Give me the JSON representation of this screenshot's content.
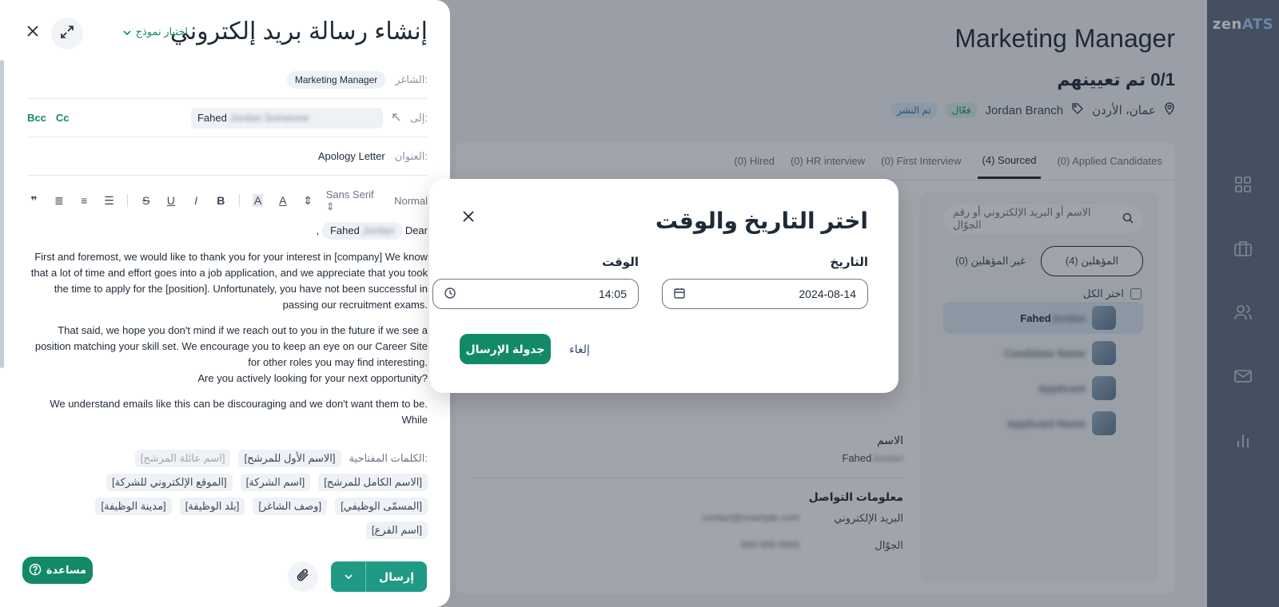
{
  "sidebar": {
    "logo_main": "zen",
    "logo_accent": "ATS",
    "icons": [
      "grid-icon",
      "briefcase-icon",
      "users-icon",
      "mail-icon",
      "chart-icon"
    ]
  },
  "job": {
    "title": "Marketing Manager",
    "hired": "0/1 تم تعيينهم",
    "location": "عمان، الأردن",
    "branch": "Jordan Branch",
    "status_active": "فعّال",
    "status_published": "تم النشر"
  },
  "tabs": [
    {
      "label": "(0) Applied Candidates",
      "active": false
    },
    {
      "label": "(4) Sourced",
      "active": true
    },
    {
      "label": "(0) First Interview",
      "active": false
    },
    {
      "label": "(0) HR interview",
      "active": false
    },
    {
      "label": "(0) Hired",
      "active": false
    }
  ],
  "candidates": {
    "search_placeholder": "الاسم أو البريد الإلكتروني أو رقم الجوّال",
    "qualified": "المؤهلين (4)",
    "unqualified": "غير المؤهلين (0)",
    "select_all": "اختر الكل",
    "rows": [
      {
        "name": "Fahed",
        "blur": "Jordan"
      },
      {
        "name": "",
        "blur": "Candidate Name"
      },
      {
        "name": "",
        "blur": "Applicant"
      },
      {
        "name": "",
        "blur": "Applicant Name"
      }
    ]
  },
  "detail": {
    "name_label": "الاسم",
    "name_value": "Fahed",
    "contact_label": "معلومات التواصل",
    "email_label": "البريد الإلكتروني",
    "phone_label": "الجوّال"
  },
  "composer": {
    "title": "إنشاء رسالة بريد إلكتروني",
    "template_select": "اختيار نموذج",
    "vacancy_label": "الشاغر:",
    "vacancy_value": "Marketing Manager",
    "to_label": "إلى:",
    "to_value": "Fahed",
    "cc": "Cc",
    "bcc": "Bcc",
    "subject_label": "العنوان:",
    "subject_value": "Apology Letter",
    "toolbar": {
      "style": "Normal",
      "font": "Sans Serif"
    },
    "greeting": "Dear",
    "greeting_name": "Fahed",
    "paragraphs": [
      "First and foremost, we would like to thank you for your interest in [company] We know that a lot of time and effort goes into a job application, and we appreciate that you took the time to apply for the [position]. Unfortunately, you have not been successful in passing our recruitment exams.",
      "That said, we hope you don't mind if we reach out to you in the future if we see a position matching your skill set. We encourage you to keep an eye on our  Career Site for other roles you may find interesting.",
      "Are you actively looking for your next opportunity?",
      "We understand emails like this can be discouraging and we don't want them to be. While"
    ],
    "keywords_label": "الكلمات المفتاحية:",
    "keywords": [
      {
        "text": "[الاسم الأول للمرشح]",
        "muted": false
      },
      {
        "text": "[اسم عائلة المرشح]",
        "muted": true
      },
      {
        "text": "[الاسم الكامل للمرشح]",
        "muted": false
      },
      {
        "text": "[اسم الشركة]",
        "muted": false
      },
      {
        "text": "[الموقع الإلكتروني للشركة]",
        "muted": false
      },
      {
        "text": "[المسمّى الوظيفي]",
        "muted": false
      },
      {
        "text": "[وصف الشاغر]",
        "muted": false
      },
      {
        "text": "[بلد الوظيفة]",
        "muted": false
      },
      {
        "text": "[مدينة الوظيفة]",
        "muted": false
      },
      {
        "text": "[اسم الفرع]",
        "muted": false
      }
    ],
    "send_label": "إرسال",
    "help_label": "مساعدة"
  },
  "modal": {
    "title": "اختر التاريخ والوقت",
    "date_label": "التاريخ",
    "date_value": "2024-08-14",
    "time_label": "الوقت",
    "time_value": "14:05",
    "schedule_label": "جدولة الإرسال",
    "cancel_label": "إلغاء"
  },
  "colors": {
    "accent": "#128a67",
    "sidebar": "#5f6b7c"
  }
}
